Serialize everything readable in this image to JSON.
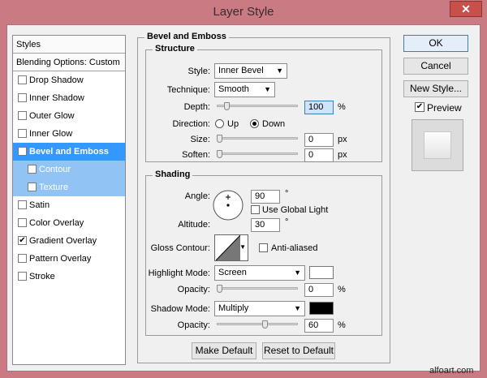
{
  "window": {
    "title": "Layer Style",
    "close_glyph": "✕"
  },
  "sidebar": {
    "header": "Styles",
    "blending": "Blending Options: Custom",
    "items": [
      {
        "label": "Drop Shadow",
        "checked": false
      },
      {
        "label": "Inner Shadow",
        "checked": false
      },
      {
        "label": "Outer Glow",
        "checked": false
      },
      {
        "label": "Inner Glow",
        "checked": false
      },
      {
        "label": "Bevel and Emboss",
        "checked": true,
        "selected": true
      },
      {
        "label": "Contour",
        "checked": false,
        "sub": true
      },
      {
        "label": "Texture",
        "checked": false,
        "sub": true
      },
      {
        "label": "Satin",
        "checked": false
      },
      {
        "label": "Color Overlay",
        "checked": false
      },
      {
        "label": "Gradient Overlay",
        "checked": true
      },
      {
        "label": "Pattern Overlay",
        "checked": false
      },
      {
        "label": "Stroke",
        "checked": false
      }
    ]
  },
  "panel": {
    "title": "Bevel and Emboss"
  },
  "structure": {
    "title": "Structure",
    "style_label": "Style:",
    "style_value": "Inner Bevel",
    "technique_label": "Technique:",
    "technique_value": "Smooth",
    "depth_label": "Depth:",
    "depth_value": "100",
    "depth_unit": "%",
    "depth_level": 0.1,
    "direction_label": "Direction:",
    "direction_up": "Up",
    "direction_down": "Down",
    "direction_selected": "Down",
    "size_label": "Size:",
    "size_value": "0",
    "size_unit": "px",
    "size_level": 0,
    "soften_label": "Soften:",
    "soften_value": "0",
    "soften_unit": "px",
    "soften_level": 0
  },
  "shading": {
    "title": "Shading",
    "angle_label": "Angle:",
    "angle_value": "90",
    "angle_unit": "°",
    "global_light_label": "Use Global Light",
    "global_light_checked": false,
    "altitude_label": "Altitude:",
    "altitude_value": "30",
    "altitude_unit": "°",
    "gloss_label": "Gloss Contour:",
    "antialias_label": "Anti-aliased",
    "antialias_checked": false,
    "highlight_label": "Highlight Mode:",
    "highlight_value": "Screen",
    "highlight_color": "#ffffff",
    "hl_opacity_label": "Opacity:",
    "hl_opacity_value": "0",
    "hl_opacity_unit": "%",
    "hl_opacity_level": 0,
    "shadow_label": "Shadow Mode:",
    "shadow_value": "Multiply",
    "shadow_color": "#000000",
    "sh_opacity_label": "Opacity:",
    "sh_opacity_value": "60",
    "sh_opacity_unit": "%",
    "sh_opacity_level": 0.6
  },
  "buttons": {
    "make_default": "Make Default",
    "reset_default": "Reset to Default",
    "ok": "OK",
    "cancel": "Cancel",
    "new_style": "New Style...",
    "preview": "Preview",
    "preview_checked": true
  },
  "watermark": "alfoart.com"
}
